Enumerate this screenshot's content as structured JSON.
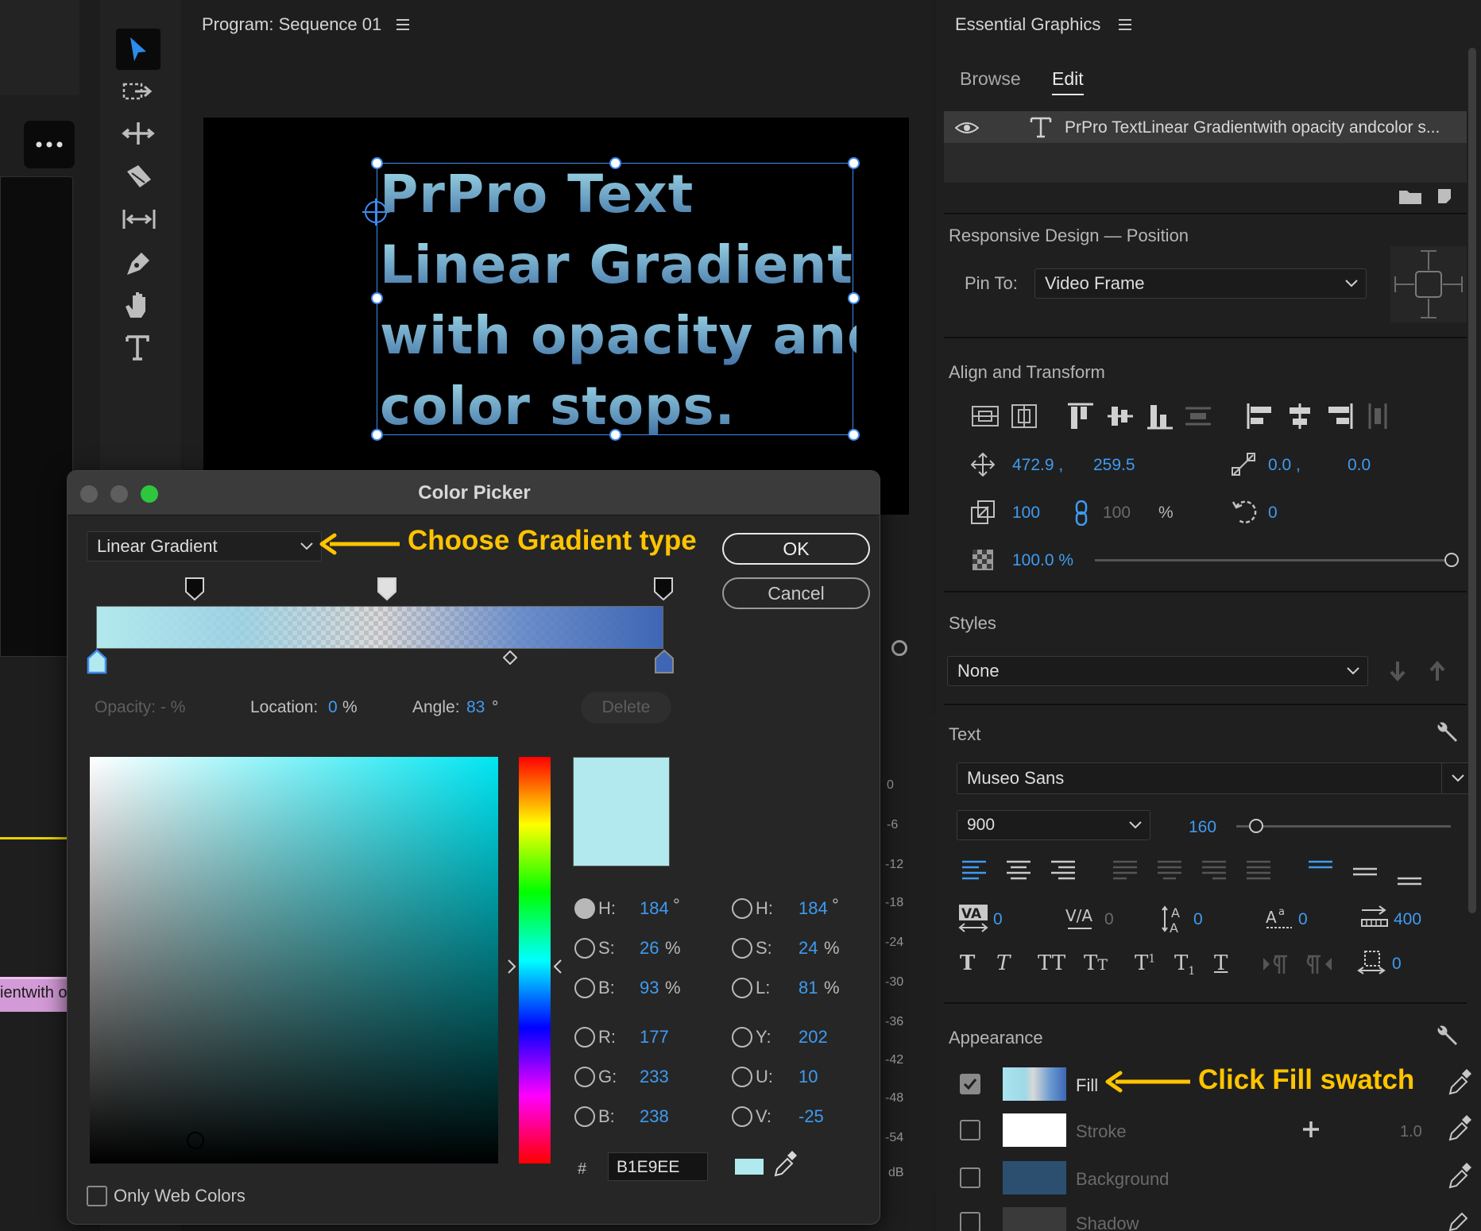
{
  "program_monitor": {
    "title": "Program: Sequence 01",
    "text_lines": [
      "PrPro Text",
      "Linear Gradient",
      "with opacity and",
      "color stops."
    ]
  },
  "timeline_clip_label": "ientwith o",
  "meter_labels": [
    "0",
    "-6",
    "-12",
    "-18",
    "-24",
    "-30",
    "-36",
    "-42",
    "-48",
    "-54",
    "dB"
  ],
  "essential_graphics": {
    "title": "Essential Graphics",
    "tabs": [
      "Browse",
      "Edit"
    ],
    "active_tab": "Edit",
    "layer_name": "PrPro TextLinear Gradientwith opacity andcolor s...",
    "responsive_title": "Responsive Design — Position",
    "pin_to_label": "Pin To:",
    "pin_to_value": "Video Frame",
    "align_title": "Align and Transform",
    "pos_x": "472.9 ,",
    "pos_y": "259.5",
    "anchor_x": "0.0 ,",
    "anchor_y": "0.0",
    "scale": "100",
    "scale_linked": "100",
    "scale_unit": "%",
    "rotation": "0",
    "opacity": "100.0 %",
    "styles_title": "Styles",
    "style_value": "None",
    "text_title": "Text",
    "font": "Museo Sans",
    "weight": "900",
    "font_size": "160",
    "kerning": "0",
    "tracking": "0",
    "leading": "0",
    "baseline": "0",
    "tab_width": "400",
    "tsume": "0",
    "appearance_title": "Appearance",
    "fill_label": "Fill",
    "stroke_label": "Stroke",
    "stroke_width": "1.0",
    "background_label": "Background",
    "shadow_label": "Shadow"
  },
  "color_picker": {
    "title": "Color Picker",
    "gradient_type": "Linear Gradient",
    "ok_label": "OK",
    "cancel_label": "Cancel",
    "opacity_label": "Opacity: - %",
    "location_label": "Location:",
    "location_value": "0",
    "location_unit": "%",
    "angle_label": "Angle:",
    "angle_value": "83",
    "angle_unit": "°",
    "delete_label": "Delete",
    "hsb": {
      "h_label": "H:",
      "h": "184",
      "h_unit": "°",
      "s_label": "S:",
      "s": "26",
      "s_unit": "%",
      "b_label": "B:",
      "b": "93",
      "b_unit": "%"
    },
    "rgb": {
      "r_label": "R:",
      "r": "177",
      "g_label": "G:",
      "g": "233",
      "b_label": "B:",
      "b": "238"
    },
    "hsl": {
      "h_label": "H:",
      "h": "184",
      "h_unit": "°",
      "s_label": "S:",
      "s": "24",
      "s_unit": "%",
      "l_label": "L:",
      "l": "81",
      "l_unit": "%"
    },
    "yuv": {
      "y_label": "Y:",
      "y": "202",
      "u_label": "U:",
      "u": "10",
      "v_label": "V:",
      "v": "-25"
    },
    "hex_label": "#",
    "hex": "B1E9EE",
    "web_colors_label": "Only Web Colors",
    "selected_color": "#b1e9ee"
  },
  "annotations": {
    "gradient_type_callout": "Choose Gradient type",
    "fill_callout": "Click Fill swatch",
    "color": "#ffc400"
  }
}
